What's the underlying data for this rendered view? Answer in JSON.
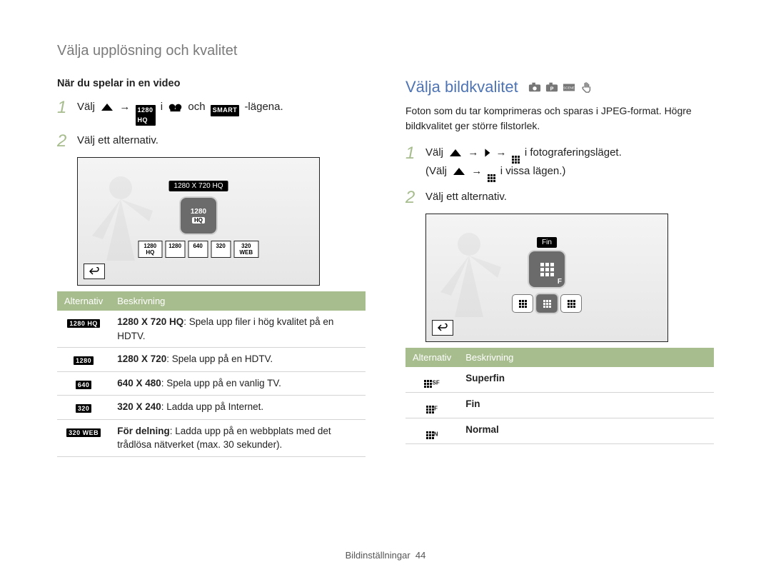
{
  "breadcrumb": "Välja upplösning och kvalitet",
  "left": {
    "heading": "När du spelar in en video",
    "step1_pre": "Välj ",
    "step1_mid": " i ",
    "step1_post1": " och ",
    "step1_post2": "-lägena.",
    "step2": "Välj ett alternativ.",
    "preview_label": "1280 X 720 HQ",
    "preview_main_top": "1280",
    "preview_main_bot": "HQ",
    "chips": [
      "1280 HQ",
      "1280",
      "640",
      "320",
      "320 WEB"
    ],
    "table_h1": "Alternativ",
    "table_h2": "Beskrivning",
    "rows": [
      {
        "ic": "1280 HQ",
        "b": "1280 X 720 HQ",
        "t": ": Spela upp filer i hög kvalitet på en HDTV."
      },
      {
        "ic": "1280",
        "b": "1280 X 720",
        "t": ": Spela upp på en HDTV."
      },
      {
        "ic": "640",
        "b": "640 X 480",
        "t": ": Spela upp på en vanlig TV."
      },
      {
        "ic": "320",
        "b": "320 X 240",
        "t": ": Ladda upp på Internet."
      },
      {
        "ic": "320 WEB",
        "b": "För delning",
        "t": ": Ladda upp på en webbplats med det trådlösa nätverket (max. 30 sekunder)."
      }
    ]
  },
  "right": {
    "title": "Välja bildkvalitet",
    "body": "Foton som du tar komprimeras och sparas i JPEG-format. Högre bildkvalitet ger större filstorlek.",
    "step1a_pre": "Välj ",
    "step1a_mid": " → ",
    "step1a_post": " i fotograferingsläget.",
    "step1b_pre": "(Välj ",
    "step1b_post": " i vissa lägen.)",
    "step2": "Välj ett alternativ.",
    "preview_label": "Fin",
    "table_h1": "Alternativ",
    "table_h2": "Beskrivning",
    "rows": [
      {
        "b": "Superfin"
      },
      {
        "b": "Fin"
      },
      {
        "b": "Normal"
      }
    ]
  },
  "footer_label": "Bildinställningar",
  "footer_page": "44"
}
